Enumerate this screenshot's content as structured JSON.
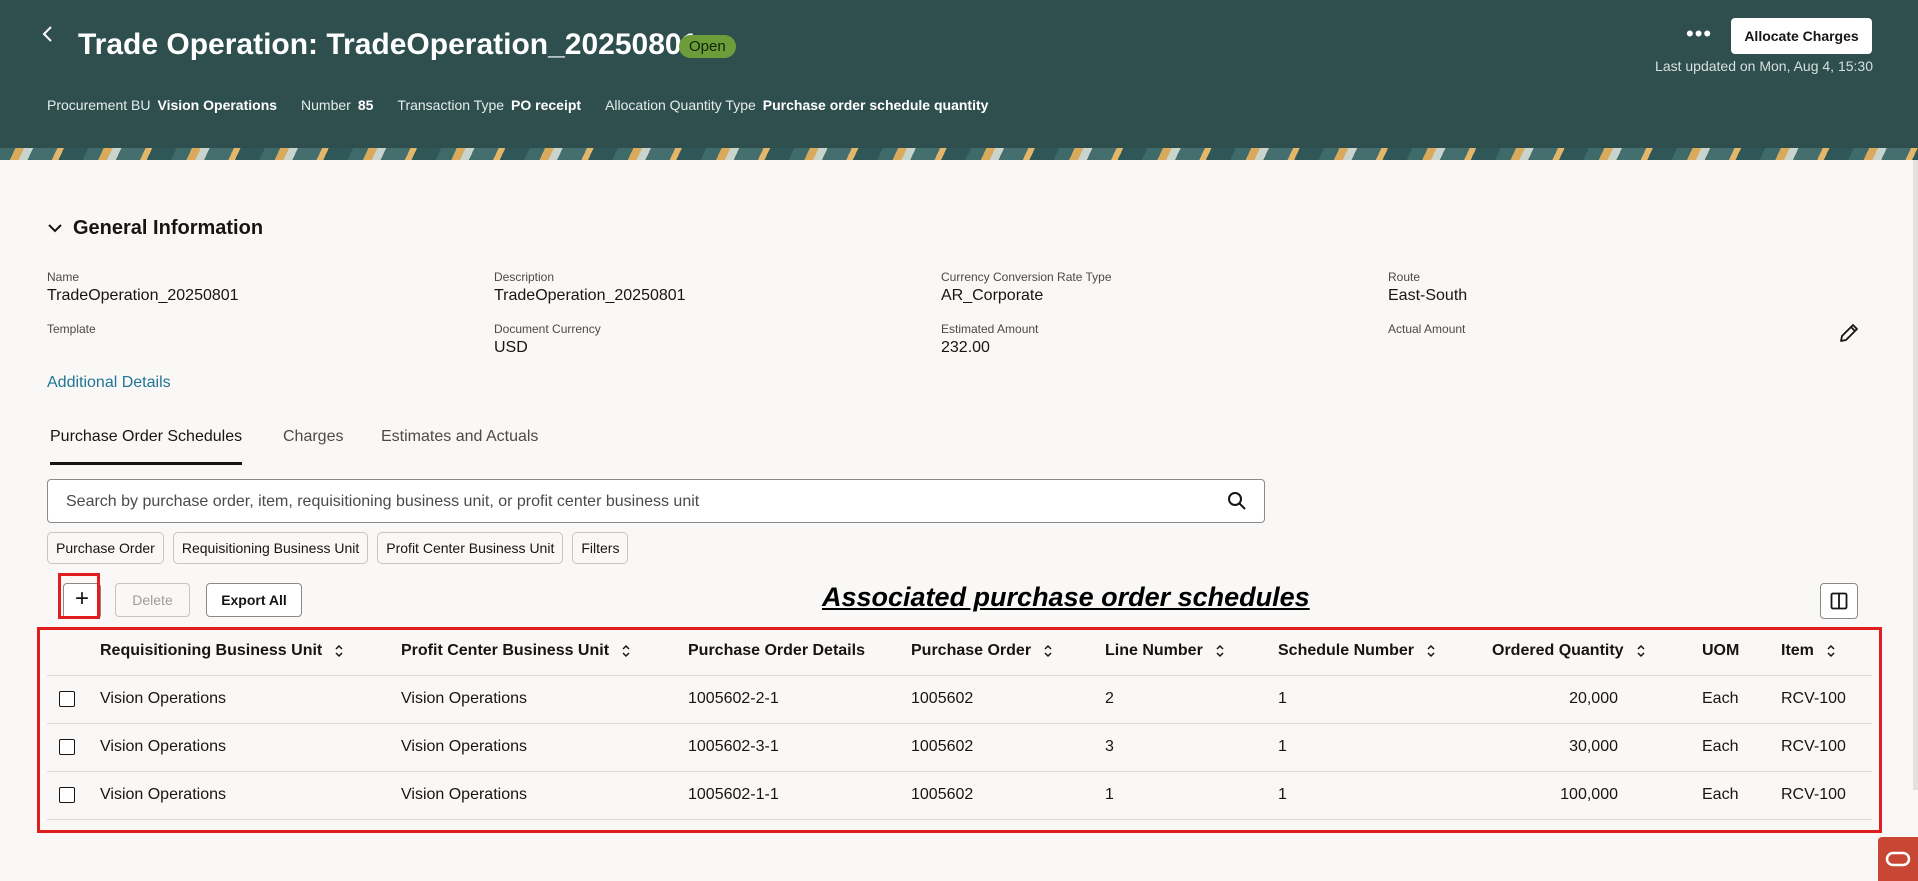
{
  "header": {
    "title": "Trade Operation: TradeOperation_20250801",
    "status": "Open",
    "allocate_button": "Allocate Charges",
    "last_updated": "Last updated on Mon, Aug 4, 15:30",
    "attributes": [
      {
        "label": "Procurement BU",
        "value": "Vision Operations"
      },
      {
        "label": "Number",
        "value": "85"
      },
      {
        "label": "Transaction Type",
        "value": "PO receipt"
      },
      {
        "label": "Allocation Quantity Type",
        "value": "Purchase order schedule quantity"
      }
    ]
  },
  "general_info": {
    "title": "General Information",
    "fields": {
      "name": {
        "label": "Name",
        "value": "TradeOperation_20250801"
      },
      "description": {
        "label": "Description",
        "value": "TradeOperation_20250801"
      },
      "currency_rate_type": {
        "label": "Currency Conversion Rate Type",
        "value": "AR_Corporate"
      },
      "route": {
        "label": "Route",
        "value": "East-South"
      },
      "template": {
        "label": "Template",
        "value": ""
      },
      "document_currency": {
        "label": "Document Currency",
        "value": "USD"
      },
      "estimated_amount": {
        "label": "Estimated Amount",
        "value": "232.00"
      },
      "actual_amount": {
        "label": "Actual Amount",
        "value": ""
      }
    },
    "additional_details": "Additional Details"
  },
  "tabs": [
    "Purchase Order Schedules",
    "Charges",
    "Estimates and Actuals"
  ],
  "search": {
    "placeholder": "Search by purchase order, item, requisitioning business unit, or profit center business unit"
  },
  "filters": [
    "Purchase Order",
    "Requisitioning Business Unit",
    "Profit Center Business Unit",
    "Filters"
  ],
  "toolbar": {
    "add": "+",
    "delete": "Delete",
    "export": "Export All"
  },
  "annotation": "Associated purchase order schedules",
  "table": {
    "columns": [
      "Requisitioning Business Unit",
      "Profit Center Business Unit",
      "Purchase Order Details",
      "Purchase Order",
      "Line Number",
      "Schedule Number",
      "Ordered Quantity",
      "UOM",
      "Item"
    ],
    "rows": [
      [
        "Vision Operations",
        "Vision Operations",
        "1005602-2-1",
        "1005602",
        "2",
        "1",
        "20,000",
        "Each",
        "RCV-100"
      ],
      [
        "Vision Operations",
        "Vision Operations",
        "1005602-3-1",
        "1005602",
        "3",
        "1",
        "30,000",
        "Each",
        "RCV-100"
      ],
      [
        "Vision Operations",
        "Vision Operations",
        "1005602-1-1",
        "1005602",
        "1",
        "1",
        "100,000",
        "Each",
        "RCV-100"
      ]
    ]
  },
  "colors": {
    "header_bg": "#2f4f4f",
    "status_badge": "#6c9d3a",
    "link": "#227595",
    "highlight": "#e01e1e",
    "brand": "#c74634"
  },
  "icons": [
    "back-icon",
    "more-icon",
    "chevron-down-icon",
    "edit-icon",
    "search-icon",
    "plus-icon",
    "sort-icon",
    "columns-icon",
    "oracle-icon"
  ]
}
